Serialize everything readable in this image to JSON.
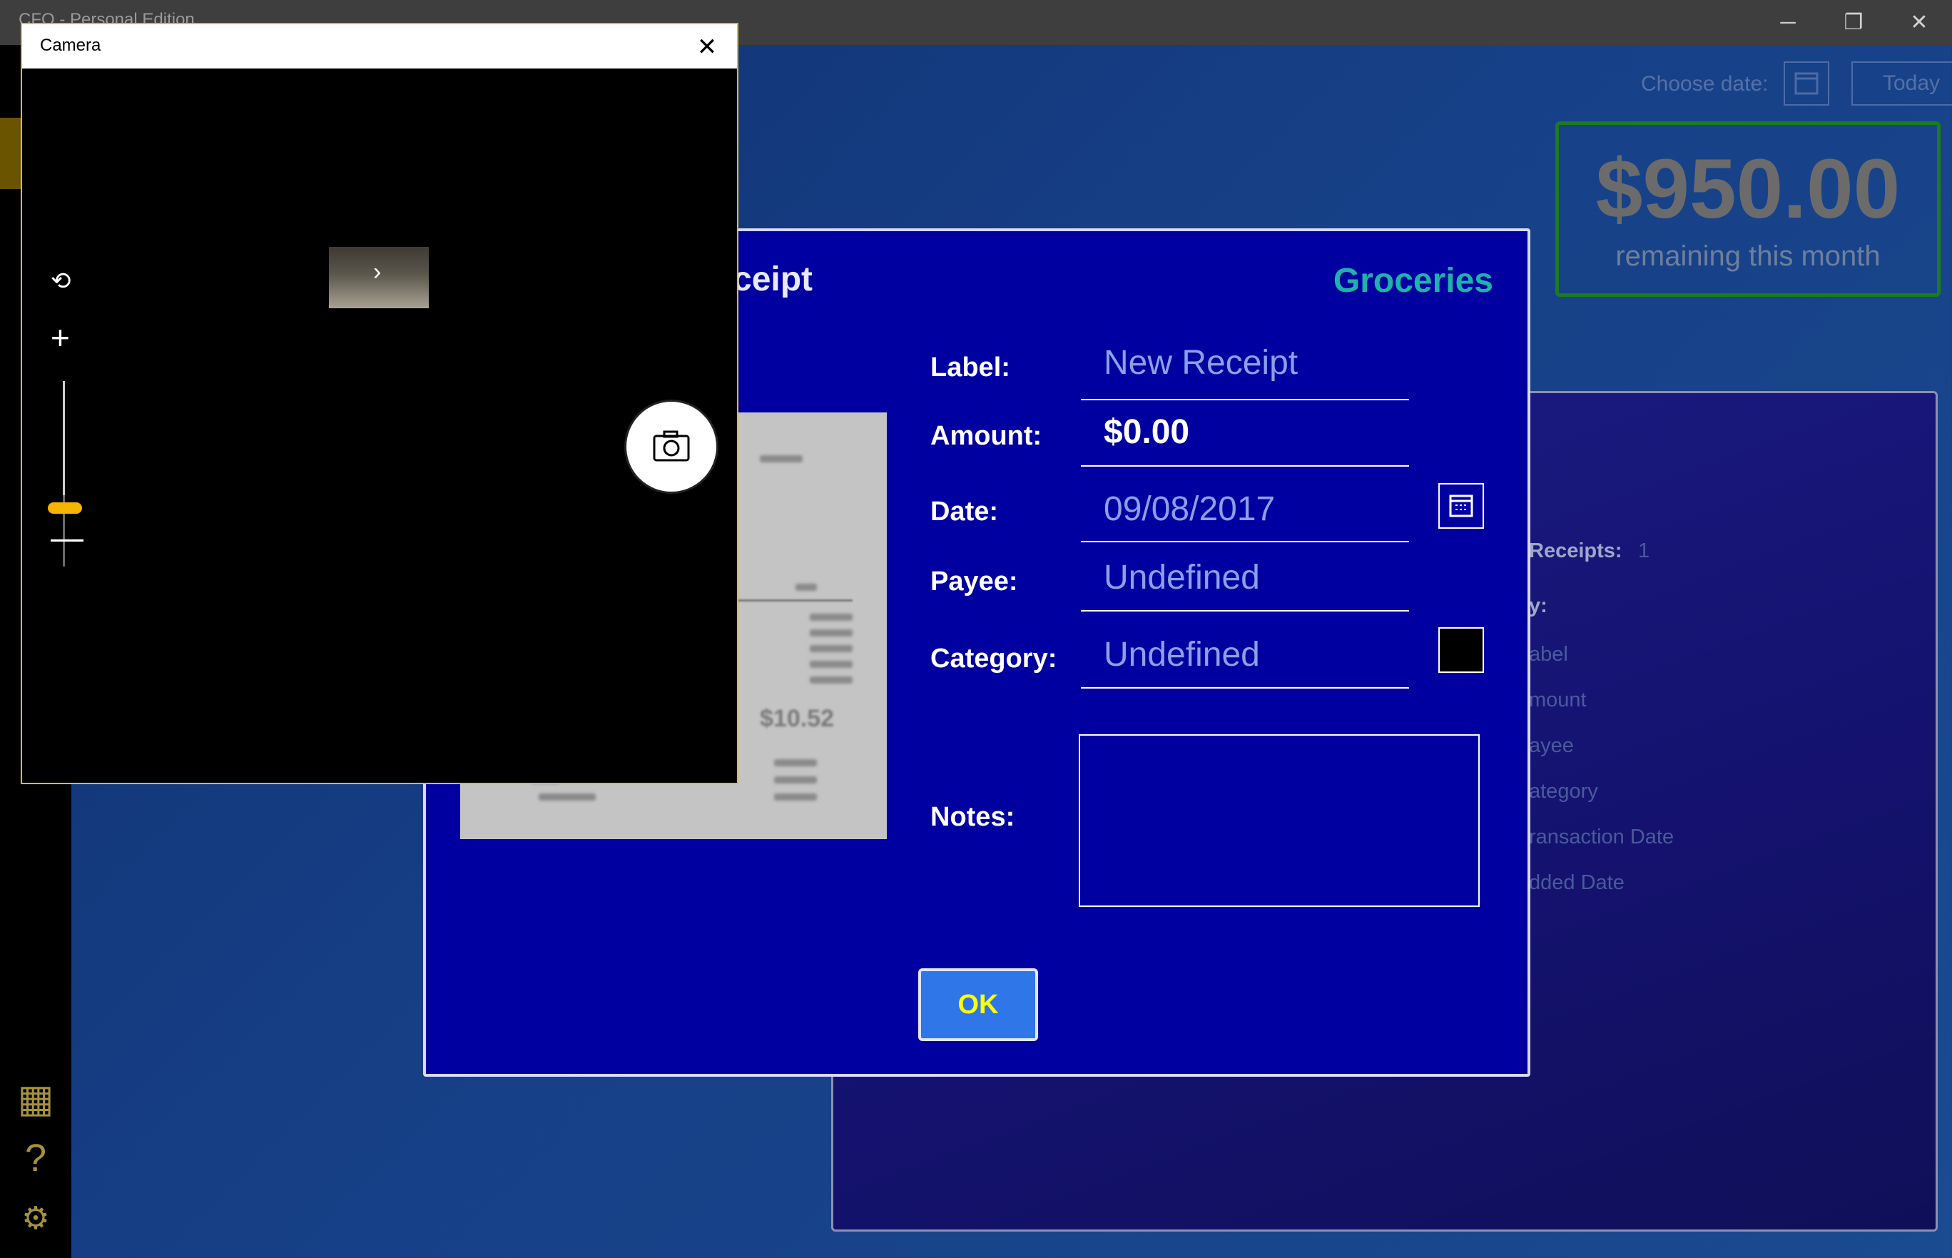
{
  "window": {
    "title": "CFO - Personal Edition",
    "minimize_icon": "─",
    "restore_icon": "❐",
    "close_icon": "✕"
  },
  "nav": {
    "calculator_icon": "▦",
    "help_icon": "?",
    "settings_icon": "⚙"
  },
  "header": {
    "choose_date_label": "Choose date:",
    "today_label": "Today",
    "remaining_amount": "$950.00",
    "remaining_label": "remaining this month"
  },
  "bg_panel": {
    "receipts_label": "Receipts:",
    "receipts_count": "1",
    "sort_by": "y:",
    "fields": [
      "abel",
      "mount",
      "ayee",
      "ategory",
      "ransaction Date",
      "dded Date"
    ]
  },
  "dialog": {
    "title": "ceipt",
    "category_name": "Groceries",
    "label_label": "Label:",
    "label_value": "New Receipt",
    "amount_label": "Amount:",
    "amount_value": "$0.00",
    "date_label": "Date:",
    "date_value": "09/08/2017",
    "payee_label": "Payee:",
    "payee_value": "Undefined",
    "category_label": "Category:",
    "category_value": "Undefined",
    "category_color": "#000000",
    "notes_label": "Notes:",
    "notes_value": "",
    "ok_label": "OK",
    "receipt_total": "$10.52"
  },
  "camera": {
    "title": "Camera",
    "close_icon": "✕",
    "chevron_icon": "›",
    "switch_icon": "⟲",
    "zoom_in_icon": "+",
    "zoom_out_icon": "—",
    "shutter_icon": "📷",
    "zoom_level": 0.4
  },
  "colors": {
    "accent_green": "#1c7b1c",
    "category_teal": "#20b2aa",
    "dialog_blue": "#0000a0",
    "ok_text": "#ffff00",
    "camera_border": "#e4b73a"
  }
}
